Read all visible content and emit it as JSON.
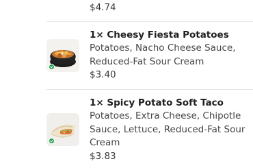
{
  "previous_item": {
    "price": "$4.74"
  },
  "items": [
    {
      "qty_title": "1× Cheesy Fiesta Potatoes",
      "description": "Potatoes, Nacho Cheese Sauce, Reduced-Fat Sour Cream",
      "price": "$3.40",
      "image_icon": "cheesy-fiesta-potatoes-image",
      "badge_icon": "vegetarian-badge-icon"
    },
    {
      "qty_title": "1× Spicy Potato Soft Taco",
      "description": "Potatoes, Extra Cheese, Chipotle Sauce, Lettuce, Reduced-Fat Sour Cream",
      "price": "$3.83",
      "image_icon": "spicy-potato-soft-taco-image",
      "badge_icon": "vegetarian-badge-icon"
    }
  ],
  "colors": {
    "veg_badge": "#1e9e4a",
    "divider": "#e6e6e6"
  }
}
